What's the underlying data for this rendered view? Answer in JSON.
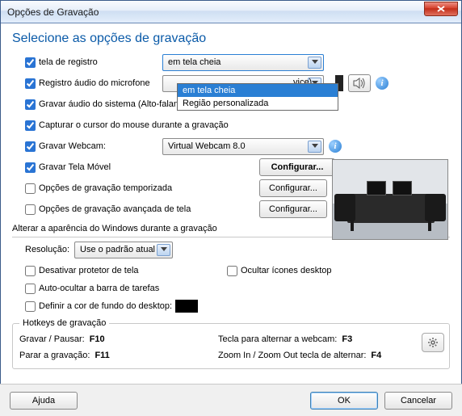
{
  "window": {
    "title": "Opções de Gravação"
  },
  "heading": "Selecione as opções de gravação",
  "registro_tela": {
    "checkbox_label": "tela de registro",
    "selected": "em tela cheia",
    "options": [
      "em tela cheia",
      "Região personalizada"
    ]
  },
  "audio_microfone": {
    "checkbox_label": "Registro áudio do microfone",
    "device_partial": "vice)"
  },
  "audio_sistema": {
    "checkbox_label": "Gravar áudio do sistema (Alto-falantes)"
  },
  "cursor": {
    "checkbox_label": "Capturar o cursor do mouse durante a gravação"
  },
  "webcam": {
    "checkbox_label": "Gravar Webcam:",
    "device": "Virtual Webcam 8.0"
  },
  "tela_movel": {
    "checkbox_label": "Gravar Tela Móvel",
    "button": "Configurar..."
  },
  "temporizada": {
    "checkbox_label": "Opções de gravação temporizada",
    "button": "Configurar..."
  },
  "avancada": {
    "checkbox_label": "Opções de gravação avançada de tela",
    "button": "Configurar..."
  },
  "aparencia": {
    "heading": "Alterar a aparência do Windows durante a gravação",
    "resolucao_label": "Resolução:",
    "resolucao_value": "Use o padrão atual",
    "desativar_protetor": "Desativar protetor de tela",
    "ocultar_icones": "Ocultar ícones desktop",
    "auto_ocultar": "Auto-ocultar a barra de tarefas",
    "definir_cor": "Definir a cor de fundo do desktop:"
  },
  "hotkeys": {
    "legend": "Hotkeys de gravação",
    "gravar_label": "Gravar / Pausar:",
    "gravar_key": "F10",
    "parar_label": "Parar a gravação:",
    "parar_key": "F11",
    "webcam_label": "Tecla para alternar a webcam:",
    "webcam_key": "F3",
    "zoom_label": "Zoom In / Zoom Out tecla de alternar:",
    "zoom_key": "F4"
  },
  "buttons": {
    "ajuda": "Ajuda",
    "ok": "OK",
    "cancelar": "Cancelar"
  },
  "info_glyph": "i"
}
